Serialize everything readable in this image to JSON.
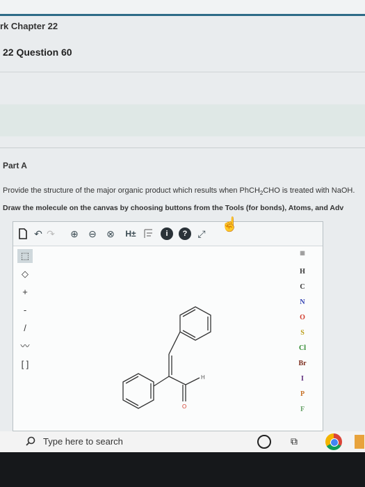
{
  "header": {
    "breadcrumb": "rk Chapter 22",
    "question_title": "22 Question 60"
  },
  "part": {
    "label": "Part A",
    "prompt_before": "Provide the structure of the major organic product which results when PhCH",
    "prompt_sub": "2",
    "prompt_after": "CHO is treated with NaOH.",
    "instruction": "Draw the molecule on the canvas by choosing buttons from the Tools (for bonds), Atoms, and Adv"
  },
  "toolbar": {
    "h_toggle": "H±",
    "info": "i",
    "help": "?"
  },
  "atoms": [
    "H",
    "C",
    "N",
    "O",
    "S",
    "Cl",
    "Br",
    "I",
    "P",
    "F"
  ],
  "atom_colors": {
    "H": "#333333",
    "C": "#333333",
    "N": "#2f3fb0",
    "O": "#d23a2a",
    "S": "#b99b12",
    "Cl": "#2f8a2f",
    "Br": "#7a2a1a",
    "I": "#5b2a7a",
    "P": "#c8742a",
    "F": "#6aa36a"
  },
  "molecule": {
    "h_label": "H",
    "o_label": "O"
  },
  "taskbar": {
    "search_placeholder": "Type here to search"
  }
}
